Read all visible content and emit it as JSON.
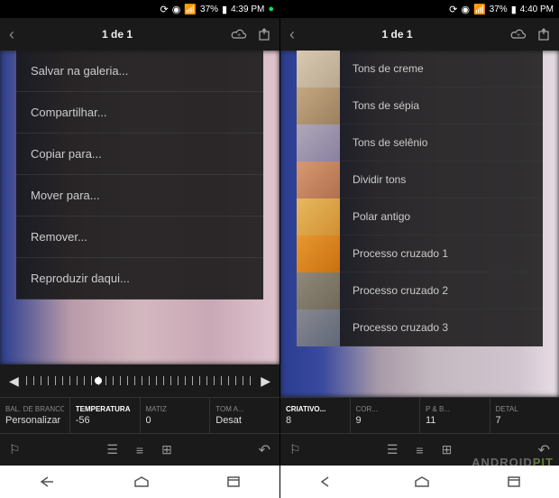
{
  "left": {
    "status": {
      "battery": "37%",
      "time": "4:39 PM"
    },
    "header": {
      "title": "1 de 1"
    },
    "menu": [
      "Salvar na galeria...",
      "Compartilhar...",
      "Copiar para...",
      "Mover para...",
      "Remover...",
      "Reproduzir daqui..."
    ],
    "params": [
      {
        "label": "BAL. DE BRANCO...",
        "value": "Personalizar"
      },
      {
        "label": "TEMPERATURA",
        "value": "-56",
        "active": true
      },
      {
        "label": "MATIZ",
        "value": "0"
      },
      {
        "label": "TOM A...",
        "value": "Desat"
      }
    ]
  },
  "right": {
    "status": {
      "battery": "37%",
      "time": "4:40 PM"
    },
    "header": {
      "title": "1 de 1"
    },
    "filters": [
      {
        "label": "Tons de creme",
        "bg": "linear-gradient(135deg,#d8c9b0,#b8a890)"
      },
      {
        "label": "Tons de sépia",
        "bg": "linear-gradient(135deg,#c4a880,#9c8060)"
      },
      {
        "label": "Tons de selênio",
        "bg": "linear-gradient(135deg,#b0a8b8,#8880a0)"
      },
      {
        "label": "Dividir tons",
        "bg": "linear-gradient(135deg,#d89870,#b07050)"
      },
      {
        "label": "Polar antigo",
        "bg": "linear-gradient(135deg,#e8b860,#d09030)"
      },
      {
        "label": "Processo cruzado 1",
        "bg": "linear-gradient(135deg,#e89830,#c87010)"
      },
      {
        "label": "Processo cruzado 2",
        "bg": "linear-gradient(135deg,#908878,#706858)"
      },
      {
        "label": "Processo cruzado 3",
        "bg": "linear-gradient(135deg,#888890,#606878)"
      }
    ],
    "params": [
      {
        "label": "CRIATIVO...",
        "value": "8",
        "active": true
      },
      {
        "label": "COR...",
        "value": "9"
      },
      {
        "label": "P & B...",
        "value": "11"
      },
      {
        "label": "DETAL",
        "value": "7"
      }
    ]
  },
  "watermark": {
    "a": "ANDROID",
    "b": "PIT"
  }
}
